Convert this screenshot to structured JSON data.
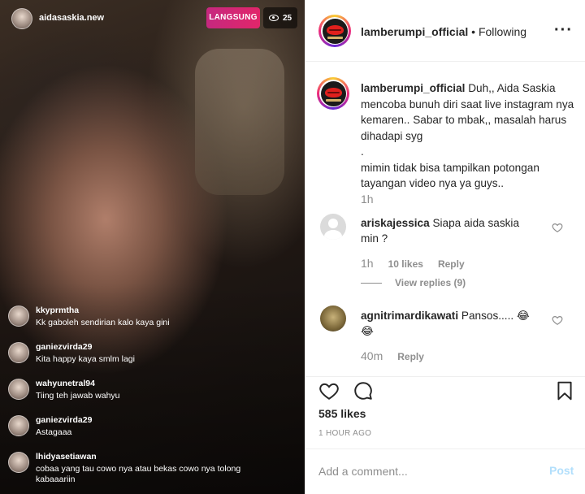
{
  "live": {
    "host_name": "aidasaskia.new",
    "live_badge": "LANGSUNG",
    "viewer_count": "25",
    "viewer_icon": "eye-icon",
    "comments": [
      {
        "user": "kkyprmtha",
        "text": "Kk gaboleh sendirian kalo kaya gini"
      },
      {
        "user": "ganiezvirda29",
        "text": "Kita happy kaya smlm lagi"
      },
      {
        "user": "wahyunetral94",
        "text": "Tiing teh jawab wahyu"
      },
      {
        "user": "ganiezvirda29",
        "text": "Astagaaa"
      },
      {
        "user": "lhidyasetiawan",
        "text": "cobaa yang tau cowo nya atau bekas cowo nya tolong kabaaariin"
      }
    ]
  },
  "post": {
    "account": "lamberumpi_official",
    "separator": "•",
    "follow_status": "Following",
    "more_icon": "more-options-icon",
    "caption": {
      "user": "lamberumpi_official",
      "lines": [
        "Duh,, Aida Saskia mencoba bunuh diri saat live instagram nya kemaren.. Sabar to mbak,, masalah harus dihadapi syg",
        ".",
        "mimin tidak bisa tampilkan potongan tayangan video nya ya guys.."
      ],
      "time": "1h"
    },
    "comments": [
      {
        "user": "ariskajessica",
        "text": "Siapa aida saskia min ?",
        "time": "1h",
        "likes": "10 likes",
        "reply": "Reply",
        "view_replies": "View replies (9)"
      },
      {
        "user": "agnitrimardikawati",
        "text": "Pansos..... 😂 😂",
        "time": "40m",
        "reply": "Reply"
      }
    ],
    "likes": "585 likes",
    "posted": "1 HOUR AGO",
    "add_comment_placeholder": "Add a comment...",
    "post_button": "Post",
    "colors": {
      "link": "#b2dffc",
      "muted": "#8e8e8e",
      "live": "#e2266a"
    }
  }
}
